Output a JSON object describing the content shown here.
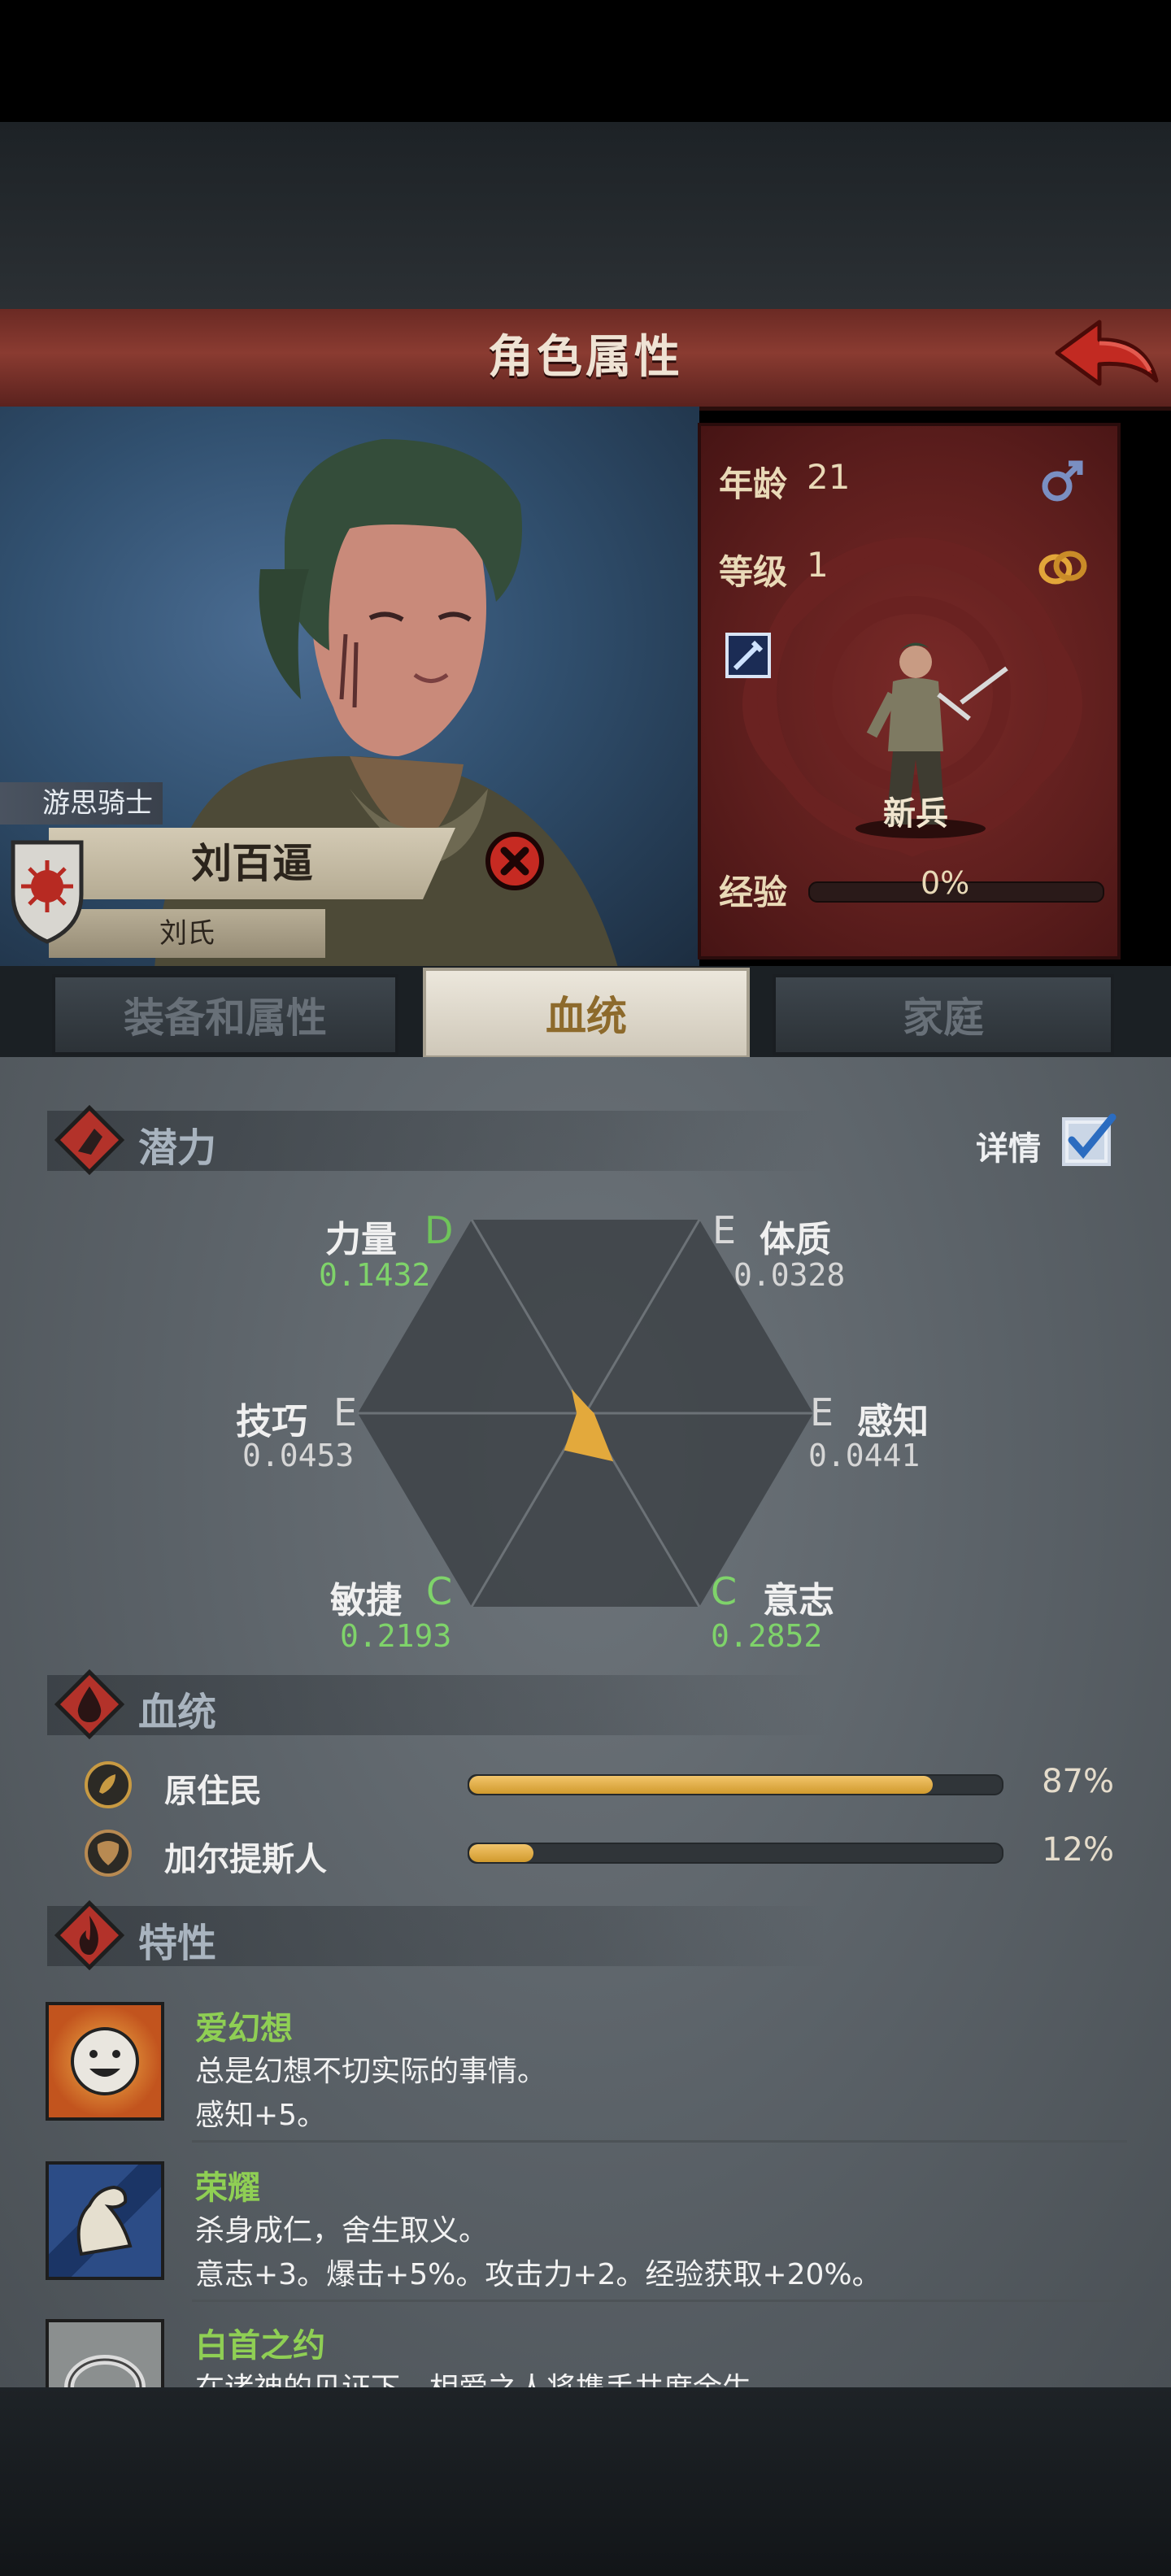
{
  "header": {
    "title": "角色属性"
  },
  "character": {
    "title": "游思骑士",
    "name": "刘百逼",
    "clan": "刘氏",
    "unit_rank": "新兵"
  },
  "info": {
    "age_label": "年龄",
    "age_value": "21",
    "level_label": "等级",
    "level_value": "1",
    "exp_label": "经验",
    "exp_value": "0%"
  },
  "tabs": [
    {
      "label": "装备和属性",
      "active": false
    },
    {
      "label": "血统",
      "active": true
    },
    {
      "label": "家庭",
      "active": false
    }
  ],
  "potential": {
    "section_title": "潜力",
    "detail_label": "详情",
    "detail_checked": true,
    "stats": [
      {
        "name": "力量",
        "grade": "D",
        "value": "0.1432"
      },
      {
        "name": "体质",
        "grade": "E",
        "value": "0.0328"
      },
      {
        "name": "技巧",
        "grade": "E",
        "value": "0.0453"
      },
      {
        "name": "感知",
        "grade": "E",
        "value": "0.0441"
      },
      {
        "name": "敏捷",
        "grade": "C",
        "value": "0.2193"
      },
      {
        "name": "意志",
        "grade": "C",
        "value": "0.2852"
      }
    ]
  },
  "bloodline": {
    "section_title": "血统",
    "lines": [
      {
        "name": "原住民",
        "percent": "87%",
        "fill": 0.87
      },
      {
        "name": "加尔提斯人",
        "percent": "12%",
        "fill": 0.12
      }
    ]
  },
  "traits": {
    "section_title": "特性",
    "items": [
      {
        "name": "爱幻想",
        "desc": "总是幻想不切实际的事情。",
        "effect": "感知+5。"
      },
      {
        "name": "荣耀",
        "desc": "杀身成仁，舍生取义。",
        "effect": "意志+3。爆击+5%。攻击力+2。经验获取+20%。"
      },
      {
        "name": "白首之约",
        "desc": "在诸神的见证下，相爱之人将携手共度余生。",
        "effect": ""
      }
    ]
  },
  "colors": {
    "grade_d": "#6fc45a",
    "grade_e": "#d9d9d9",
    "grade_c": "#7fd36a",
    "accent_gold": "#e3a93c",
    "trait_name": "#8fcf54",
    "title_bar": "#7a3229"
  }
}
